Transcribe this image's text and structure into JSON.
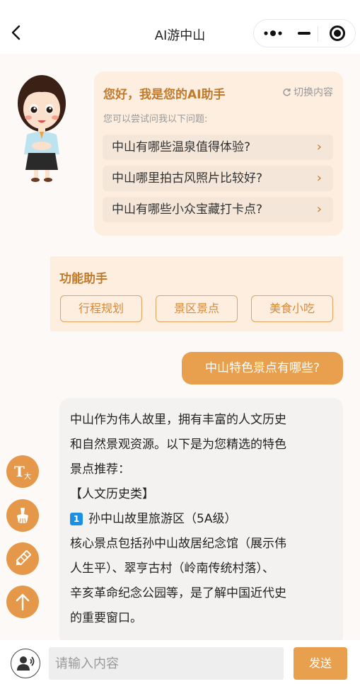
{
  "nav": {
    "title": "AI游中山"
  },
  "greeting": {
    "title": "您好，我是您的AI助手",
    "switch_label": "切换内容",
    "subtitle": "您可以尝试问我以下问题:",
    "questions": [
      "中山有哪些温泉值得体验?",
      "中山哪里拍古风照片比较好?",
      "中山有哪些小众宝藏打卡点?"
    ]
  },
  "function_helper": {
    "title": "功能助手",
    "buttons": [
      "行程规划",
      "景区景点",
      "美食小吃"
    ]
  },
  "chat": {
    "user_message": "中山特色景点有哪些?",
    "ai_lines": [
      "中山作为伟人故里，拥有丰富的人文历史",
      "和自然景观资源。以下是为您精选的特色",
      "景点推荐：",
      "【人文历史类】",
      "孙中山故里旅游区（5A级）",
      "核心景点包括孙中山故居纪念馆（展示伟",
      "人生平）、翠亨古村（岭南传统村落）、",
      "辛亥革命纪念公园等，是了解中国近代史",
      "的重要窗口。"
    ],
    "badge_number": "1"
  },
  "float_buttons": [
    "font-size-icon",
    "clean-icon",
    "edit-icon",
    "back-to-top-icon"
  ],
  "input": {
    "placeholder": "请输入内容",
    "value": ""
  },
  "send_label": "发送",
  "colors": {
    "accent": "#e8a04e",
    "card_bg": "#fdeee0",
    "title_brown": "#c07a2c"
  }
}
